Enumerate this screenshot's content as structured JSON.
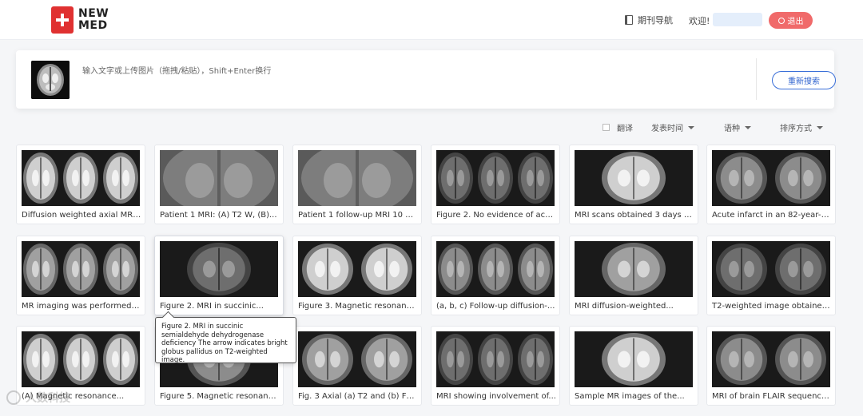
{
  "header": {
    "logo_line1": "NEW",
    "logo_line2": "MED",
    "journal_nav": "期刊导航",
    "welcome": "欢迎!",
    "logout": "退出"
  },
  "search": {
    "placeholder": "输入文字或上传图片（拖拽/粘贴），Shift+Enter换行",
    "research_button": "重新搜索"
  },
  "filters": {
    "translate": "翻译",
    "publish_time": "发表时间",
    "language": "语种",
    "sort": "排序方式"
  },
  "cards": [
    {
      "caption": "Diffusion weighted axial MRI..."
    },
    {
      "caption": "Patient 1 MRI: (A) T2 W, (B)..."
    },
    {
      "caption": "Patient 1 follow-up MRI 10 da..."
    },
    {
      "caption": "Figure 2. No evidence of acut..."
    },
    {
      "caption": "MRI scans obtained 3 days aft..."
    },
    {
      "caption": "Acute infarct in an 82-year-ol..."
    },
    {
      "caption": "MR imaging was performed at..."
    },
    {
      "caption": "Figure 2. MRI in succinic..."
    },
    {
      "caption": "Figure 3. Magnetic resonance..."
    },
    {
      "caption": "(a, b, c) Follow-up diffusion-..."
    },
    {
      "caption": "MRI diffusion-weighted..."
    },
    {
      "caption": "T2-weighted image obtained ..."
    },
    {
      "caption": "(A) Magnetic resonance..."
    },
    {
      "caption": "Figure 5. Magnetic resonance..."
    },
    {
      "caption": "Fig. 3 Axial (a) T2 and (b) FLAI..."
    },
    {
      "caption": "MRI showing involvement of..."
    },
    {
      "caption": "Sample MR images of the..."
    },
    {
      "caption": "MRI of brain FLAIR sequence..."
    }
  ],
  "tooltip": {
    "text": "Figure 2. MRI in succinic semialdehyde dehydrogenase deficiency The arrow indicates bright globus pallidus on T2-weighted image."
  },
  "watermark": "人数科技"
}
